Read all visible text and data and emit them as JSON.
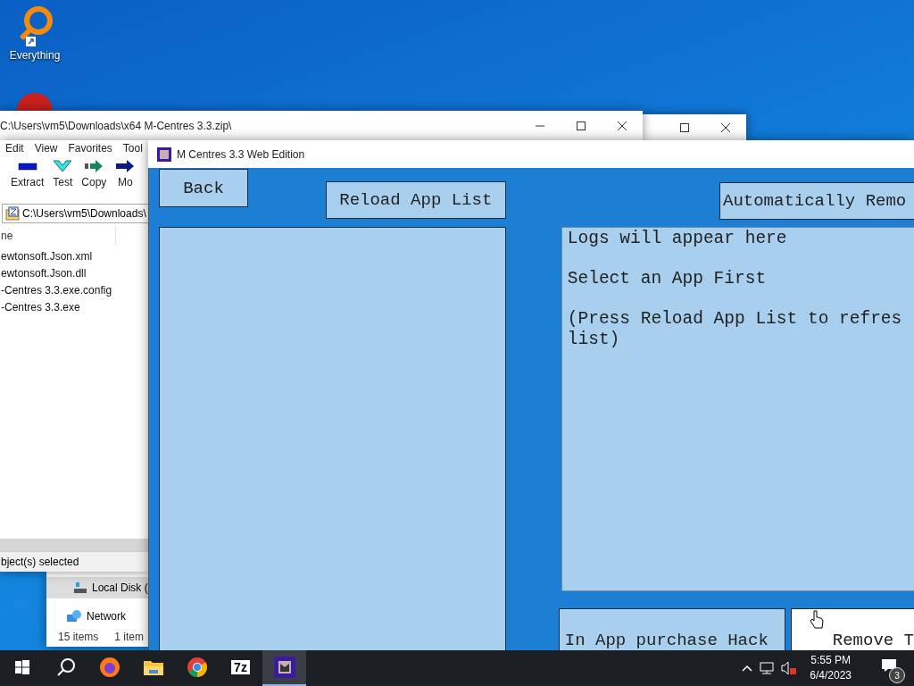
{
  "desktop_icons": [
    {
      "kind": "magnifier",
      "label": "Everything"
    },
    {
      "kind": "round"
    }
  ],
  "explorer_window": {
    "items": [
      "Local Disk (",
      "Network"
    ],
    "status": [
      "15 items",
      "1 item"
    ]
  },
  "zip_window": {
    "title": "C:\\Users\\vm5\\Downloads\\x64 M-Centres 3.3.zip\\",
    "menu": [
      "Edit",
      "View",
      "Favorites",
      "Tool"
    ],
    "toolbar": [
      {
        "kind": "extract",
        "label": "Extract"
      },
      {
        "kind": "test",
        "label": "Test"
      },
      {
        "kind": "copy",
        "label": "Copy"
      },
      {
        "kind": "move",
        "label": "Mo"
      }
    ],
    "address": "C:\\Users\\vm5\\Downloads\\",
    "column": "ne",
    "files": [
      "ewtonsoft.Json.xml",
      "ewtonsoft.Json.dll",
      "-Centres 3.3.exe.config",
      "-Centres 3.3.exe"
    ],
    "status": "bject(s) selected"
  },
  "app_window": {
    "title": "M Centres 3.3 Web Edition",
    "back": "Back",
    "reload": "Reload App List",
    "auto_remove": "Automatically Remo",
    "log": [
      {
        "lines": [
          "Logs will appear here"
        ]
      },
      {
        "lines": [
          "Select an App First"
        ]
      },
      {
        "lines": [
          "(Press Reload App List to refres",
          "list)"
        ]
      }
    ],
    "bottom_buttons": [
      {
        "label": "In App purchase Hack",
        "hovered": false
      },
      {
        "label": "Remove T",
        "hovered": true
      }
    ]
  },
  "taskbar": {
    "apps": [
      {
        "kind": "start",
        "active": false
      },
      {
        "kind": "search",
        "active": false
      },
      {
        "kind": "firefox",
        "active": false
      },
      {
        "kind": "folder",
        "active": false
      },
      {
        "kind": "chrome",
        "active": false
      },
      {
        "kind": "sevenzip",
        "label": "7z",
        "active": false
      },
      {
        "kind": "app",
        "active": true
      }
    ],
    "time": "5:55 PM",
    "date": "6/4/2023",
    "notifications": "3"
  }
}
